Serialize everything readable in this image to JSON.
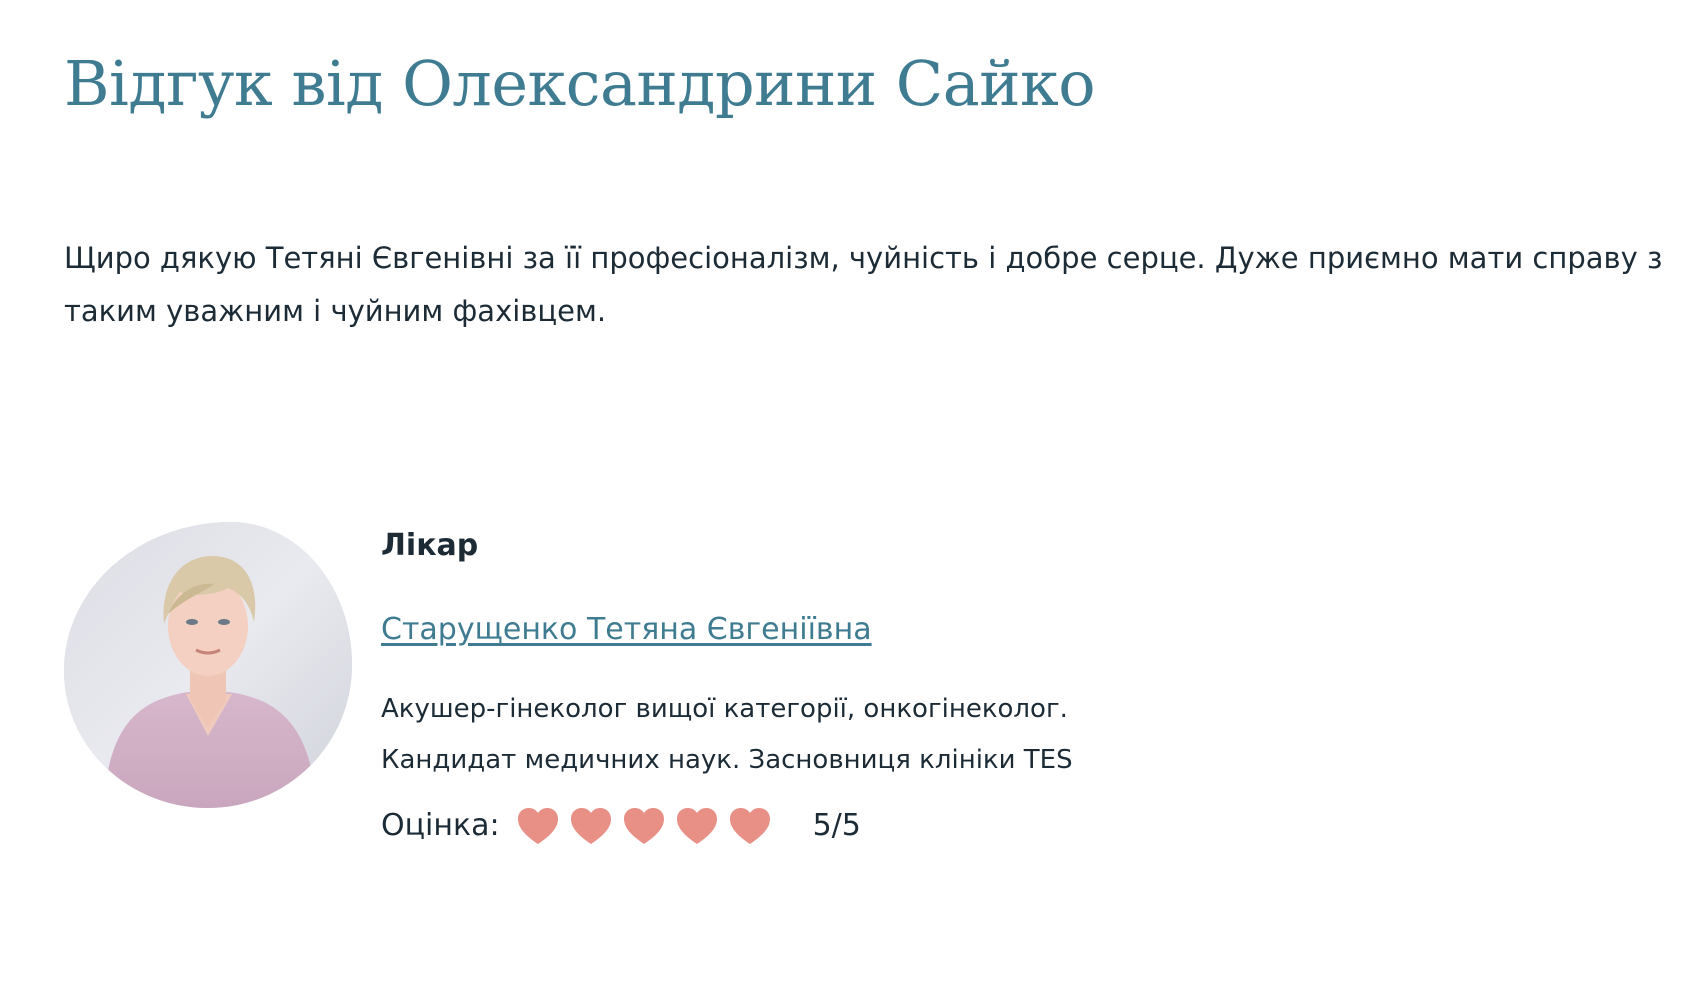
{
  "review": {
    "title": "Відгук від Олександрини Сайко",
    "text": "Щиро дякую Тетяні Євгенівні за її професіоналізм, чуйність і добре серце. Дуже приємно мати справу з таким уважним і чуйним фахівцем."
  },
  "doctor": {
    "label": "Лікар",
    "name": "Старущенко Тетяна Євгеніївна",
    "description_line1": "Акушер-гінеколог вищої категорії, онкогінеколог.",
    "description_line2": "Кандидат медичних наук. Засновниця клініки TES",
    "photo_icon": "doctor-photo"
  },
  "rating": {
    "label": "Оцінка:",
    "value": 5,
    "max": 5,
    "display": "5/5",
    "icon": "heart-icon",
    "heart_color": "#e89086"
  },
  "colors": {
    "accent": "#3f7c91",
    "text": "#1c2b36"
  }
}
